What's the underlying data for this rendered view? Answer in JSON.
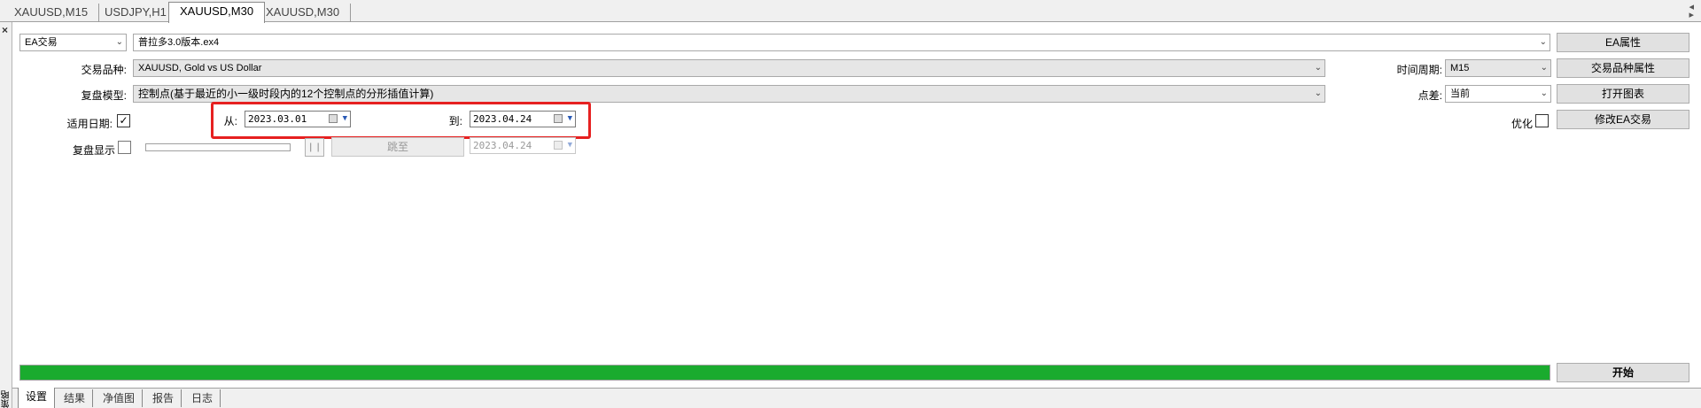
{
  "chart_tabs": [
    {
      "label": "XAUUSD,M15"
    },
    {
      "label": "USDJPY,H1"
    },
    {
      "label": "XAUUSD,M30"
    },
    {
      "label": "XAUUSD,M30"
    }
  ],
  "side_panel_label": "策略测试",
  "settings": {
    "mode_select": "EA交易",
    "ea_file": "普拉多3.0版本.ex4",
    "symbol_label": "交易品种:",
    "symbol_value": "XAUUSD, Gold vs US Dollar",
    "model_label": "复盘模型:",
    "model_value": "控制点(基于最近的小一级时段内的12个控制点的分形插值计算)",
    "use_date_label": "适用日期:",
    "use_date_checked": true,
    "from_label": "从:",
    "from_date": "2023.03.01",
    "to_label": "到:",
    "to_date": "2023.04.24",
    "visual_label": "复盘显示",
    "visual_checked": false,
    "skip_button": "跳至",
    "skip_date": "2023.04.24",
    "timeframe_label": "时间周期:",
    "timeframe_value": "M15",
    "spread_label": "点差:",
    "spread_value": "当前",
    "optimize_label": "优化",
    "optimize_checked": false
  },
  "buttons": {
    "ea_properties": "EA属性",
    "symbol_properties": "交易品种属性",
    "open_chart": "打开图表",
    "modify_ea": "修改EA交易",
    "start": "开始"
  },
  "progress": {
    "fraction": 1.0,
    "color": "#1aab2e"
  },
  "bottom_tabs": [
    {
      "label": "设置"
    },
    {
      "label": "结果"
    },
    {
      "label": "净值图"
    },
    {
      "label": "报告"
    },
    {
      "label": "日志"
    }
  ],
  "highlight_color": "#e62020"
}
